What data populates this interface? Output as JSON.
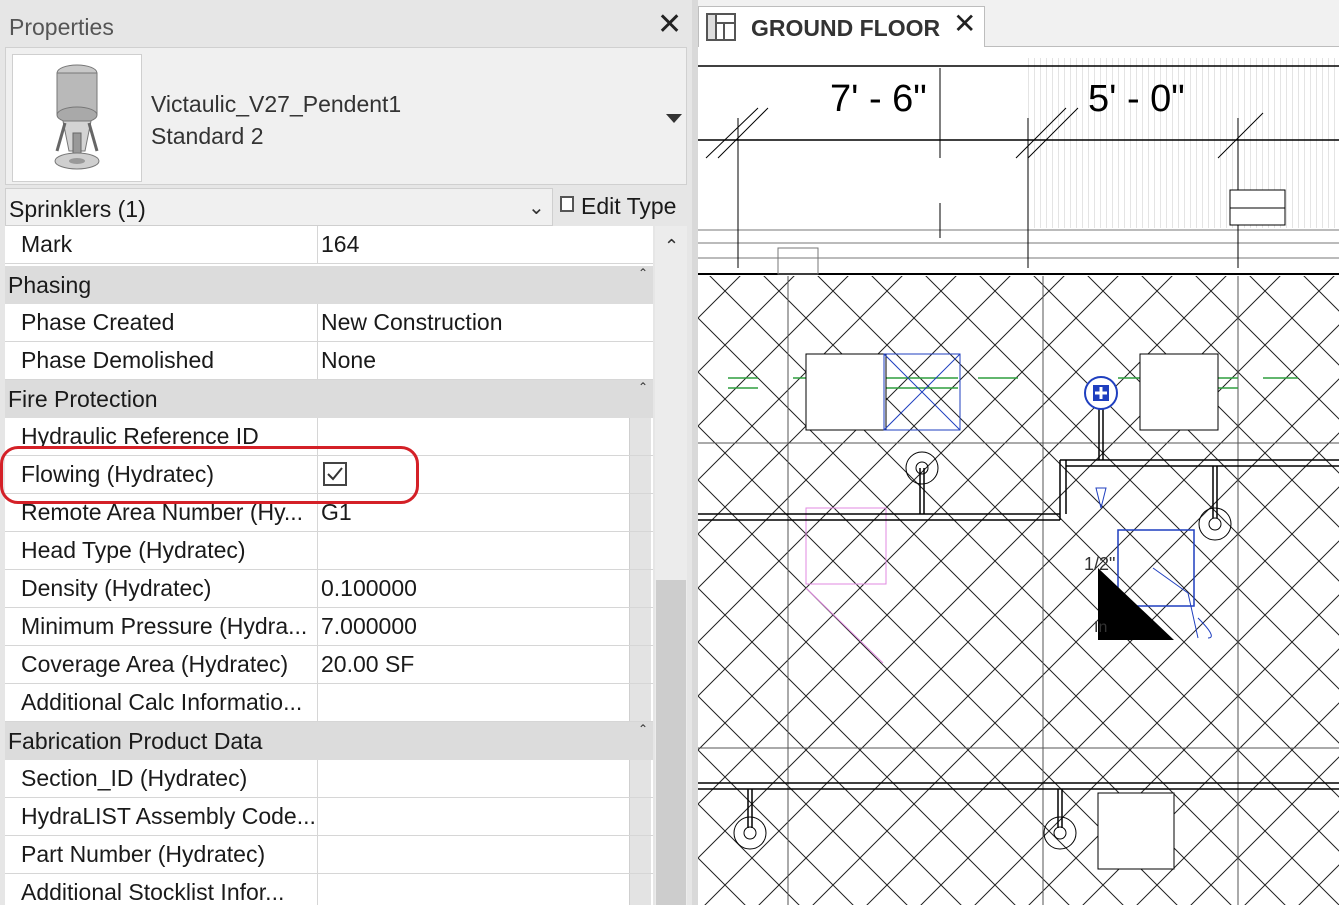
{
  "properties": {
    "title": "Properties",
    "type_name": "Victaulic_V27_Pendent1",
    "type_sub": "Standard 2",
    "category": "Sprinklers (1)",
    "edit_type": "Edit Type",
    "rows": {
      "mark": {
        "name": "Mark",
        "value": "164"
      },
      "phase_created": {
        "name": "Phase Created",
        "value": "New Construction"
      },
      "phase_demolished": {
        "name": "Phase Demolished",
        "value": "None"
      },
      "hydraulic_ref": {
        "name": "Hydraulic Reference ID",
        "value": ""
      },
      "flowing": {
        "name": "Flowing (Hydratec)",
        "checked": true
      },
      "remote_area": {
        "name": "Remote Area Number (Hy...",
        "value": "G1"
      },
      "head_type": {
        "name": "Head Type (Hydratec)",
        "value": ""
      },
      "density": {
        "name": "Density (Hydratec)",
        "value": "0.100000"
      },
      "min_pressure": {
        "name": "Minimum Pressure (Hydra...",
        "value": "7.000000"
      },
      "coverage": {
        "name": "Coverage Area (Hydratec)",
        "value": "20.00 SF"
      },
      "calc_info": {
        "name": "Additional Calc Informatio...",
        "value": ""
      },
      "section_id": {
        "name": "Section_ID (Hydratec)",
        "value": ""
      },
      "hydralist": {
        "name": "HydraLIST Assembly Code...",
        "value": ""
      },
      "part_number": {
        "name": "Part Number (Hydratec)",
        "value": ""
      },
      "stocklist": {
        "name": "Additional Stocklist Infor...",
        "value": ""
      }
    },
    "groups": {
      "phasing": "Phasing",
      "fire_protection": "Fire Protection",
      "fabrication": "Fabrication Product Data"
    }
  },
  "view": {
    "tab_label": "GROUND FLOOR",
    "dim_1": "7' - 6\"",
    "dim_2": "5' - 0\"",
    "tag_1": "1/2\"",
    "tag_2": "In"
  },
  "colors": {
    "highlight": "#d42027",
    "sprinkler_selected": "#1f3fbf",
    "grid_green": "#2e9e3e",
    "magenta": "#e08ae0"
  },
  "icons": [
    "close-icon",
    "dropdown-arrow-icon",
    "chevron-down-icon",
    "edit-type-icon",
    "collapse-icon",
    "scroll-up-icon",
    "floor-plan-icon",
    "checkbox-icon",
    "sprinkler-icon"
  ]
}
